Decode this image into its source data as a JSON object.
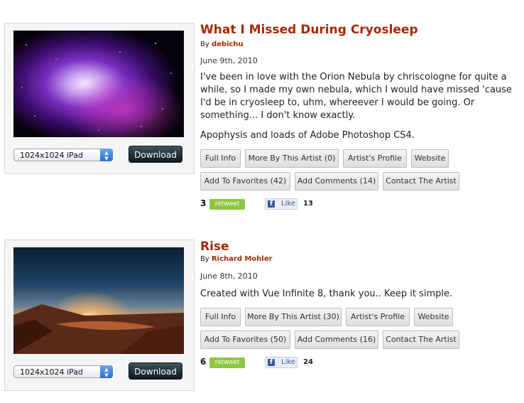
{
  "entries": [
    {
      "title": "What I Missed During Cryosleep",
      "by_prefix": "By",
      "author": "debichu",
      "date": "June 9th, 2010",
      "description": [
        "I've been in love with the Orion Nebula by chriscologne for quite a while, so I made my own nebula, which I would have missed 'cause I'd be in cryosleep to, uhm, whereever I would be going. Or something... I don't know exactly.",
        "Apophysis and loads of Adobe Photoshop CS4."
      ],
      "resolution": "1024x1024 iPad",
      "download_label": "Download",
      "buttons": {
        "full_info": "Full Info",
        "more_by_artist": "More By This Artist (0)",
        "artists_profile": "Artist's Profile",
        "website": "Website",
        "add_to_favorites": "Add To Favorites (42)",
        "add_comments": "Add Comments (14)",
        "contact_artist": "Contact The Artist"
      },
      "retweet_count": "3",
      "retweet_label": "retweet",
      "like_label": "Like",
      "like_count": "13",
      "thumbnail": "purple nebula"
    },
    {
      "title": "Rise",
      "by_prefix": "By",
      "author": "Richard Mohler",
      "date": "June 8th, 2010",
      "description": [
        "Created with Vue Infinite 8, thank you.. Keep it simple."
      ],
      "resolution": "1024x1024 iPad",
      "download_label": "Download",
      "buttons": {
        "full_info": "Full Info",
        "more_by_artist": "More By This Artist (30)",
        "artists_profile": "Artist's Profile",
        "website": "Website",
        "add_to_favorites": "Add To Favorites (50)",
        "add_comments": "Add Comments (16)",
        "contact_artist": "Contact The Artist"
      },
      "retweet_count": "6",
      "retweet_label": "retweet",
      "like_label": "Like",
      "like_count": "24",
      "thumbnail": "sunset over lake"
    }
  ],
  "colors": {
    "title": "#a52a00",
    "retweet": "#8ec63f",
    "facebook": "#3b5998"
  },
  "icons": {
    "select_arrows": "up-down-chevron-icon",
    "facebook": "facebook-f-icon"
  }
}
